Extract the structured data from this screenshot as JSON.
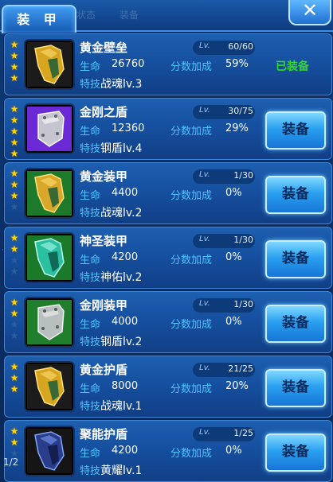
{
  "header": {
    "active_tab": "装 甲",
    "dim_tabs": [
      "状态",
      "装备"
    ],
    "close_label": "✕"
  },
  "labels": {
    "hp": "生命",
    "bonus": "分数加成",
    "skill": "特技",
    "lv": "Lv."
  },
  "items": [
    {
      "name": "黄金壁垒",
      "level": "60/60",
      "hp": "26760",
      "bonus": "59%",
      "skill": "战魂lv.3",
      "stars_on": 4,
      "stars_total": 4,
      "status": "已装备",
      "equip_label": "",
      "theme": "gold"
    },
    {
      "name": "金刚之盾",
      "level": "30/75",
      "hp": "12360",
      "bonus": "29%",
      "skill": "钢盾lv.4",
      "stars_on": 5,
      "stars_total": 5,
      "status": "",
      "equip_label": "装备",
      "theme": "purple"
    },
    {
      "name": "黄金装甲",
      "level": "1/30",
      "hp": "4400",
      "bonus": "0%",
      "skill": "战魂lv.2",
      "stars_on": 3,
      "stars_total": 4,
      "status": "",
      "equip_label": "装备",
      "theme": "gold-green"
    },
    {
      "name": "神圣装甲",
      "level": "1/30",
      "hp": "4200",
      "bonus": "0%",
      "skill": "神佑lv.2",
      "stars_on": 2,
      "stars_total": 4,
      "status": "",
      "equip_label": "装备",
      "theme": "teal"
    },
    {
      "name": "金刚装甲",
      "level": "1/30",
      "hp": "4000",
      "bonus": "0%",
      "skill": "钢盾lv.2",
      "stars_on": 2,
      "stars_total": 4,
      "status": "",
      "equip_label": "装备",
      "theme": "silver-green"
    },
    {
      "name": "黄金护盾",
      "level": "21/25",
      "hp": "8000",
      "bonus": "20%",
      "skill": "战魂lv.1",
      "stars_on": 3,
      "stars_total": 3,
      "status": "",
      "equip_label": "装备",
      "theme": "gold"
    },
    {
      "name": "聚能护盾",
      "level": "1/25",
      "hp": "4200",
      "bonus": "0%",
      "skill": "黄耀lv.1",
      "stars_on": 2,
      "stars_total": 3,
      "status": "",
      "equip_label": "装备",
      "theme": "dark"
    }
  ],
  "page_indicator": "1/2"
}
